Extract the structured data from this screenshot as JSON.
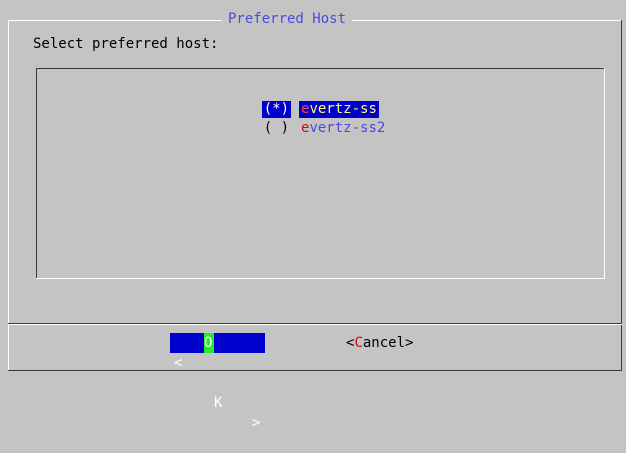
{
  "dialog": {
    "title": "Preferred Host",
    "prompt": "Select preferred host:"
  },
  "list": {
    "items": [
      {
        "mark": "(*)",
        "hot": "e",
        "rest": "vertz-ss",
        "selected": true
      },
      {
        "mark": "( )",
        "hot": "e",
        "rest": "vertz-ss2",
        "selected": false
      }
    ]
  },
  "buttons": {
    "ok": {
      "left": "<",
      "hot": "O",
      "rest": "K",
      "right": ">"
    },
    "cancel": {
      "left": "<",
      "hot": "C",
      "rest": "ancel",
      "right": ">"
    }
  },
  "colors": {
    "background": "#c4c4c4",
    "title": "#4a4ae0",
    "selection": "#0000cc",
    "hotkey": "#e00000",
    "ok_hotkey_cursor": "#22ee22",
    "item_text": "#4a4ae0",
    "selected_item_text": "#ffff66"
  }
}
